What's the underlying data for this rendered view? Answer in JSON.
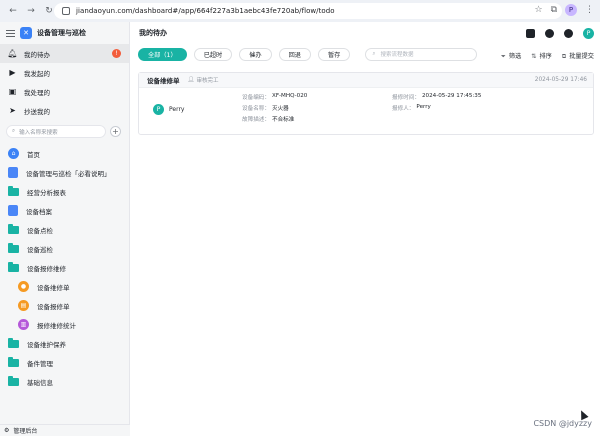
{
  "browser": {
    "url": "jiandaoyun.com/dashboard#/app/664f227a3b1aebc43fe720ab/flow/todo",
    "profile_initial": "P"
  },
  "app": {
    "title": "设备管理与巡检",
    "logo_glyph": "✕"
  },
  "sidebar": {
    "flow_items": [
      {
        "label": "我的待办",
        "icon": "bell-icon",
        "badge": "!"
      },
      {
        "label": "我发起的",
        "icon": "play-icon"
      },
      {
        "label": "我处理的",
        "icon": "inbox-icon"
      },
      {
        "label": "抄送我的",
        "icon": "send-icon"
      }
    ],
    "search_placeholder": "输入名称来搜索",
    "tree": [
      {
        "label": "首页",
        "icon": "home-icon"
      },
      {
        "label": "设备管理与巡检「必看说明」",
        "icon": "doc-icon"
      },
      {
        "label": "经营分析报表",
        "icon": "folder-icon"
      },
      {
        "label": "设备档案",
        "icon": "doc-icon"
      },
      {
        "label": "设备点检",
        "icon": "folder-icon"
      },
      {
        "label": "设备巡检",
        "icon": "folder-icon"
      },
      {
        "label": "设备报修维修",
        "icon": "folder-icon"
      },
      {
        "label": "设备维修单",
        "icon": "user-circle-icon",
        "color": "#f59a23",
        "sub": true
      },
      {
        "label": "设备报修单",
        "icon": "clipboard-circle-icon",
        "color": "#f59a23",
        "sub": true
      },
      {
        "label": "报修维修统计",
        "icon": "chart-circle-icon",
        "color": "#b558d9",
        "sub": true
      },
      {
        "label": "设备维护保养",
        "icon": "folder-icon"
      },
      {
        "label": "备件管理",
        "icon": "folder-icon"
      },
      {
        "label": "基础信息",
        "icon": "folder-icon"
      }
    ],
    "footer_label": "管理后台"
  },
  "main": {
    "title": "我的待办",
    "tabs": [
      {
        "label": "全部（1）",
        "active": true
      },
      {
        "label": "已超时"
      },
      {
        "label": "催办"
      },
      {
        "label": "回退"
      },
      {
        "label": "暂存"
      }
    ],
    "search_placeholder": "搜索流程数据",
    "actions": {
      "filter": "筛选",
      "sort": "排序",
      "batch": "批量提交"
    },
    "header_avatar": "P"
  },
  "card": {
    "title": "设备维修单",
    "node": "审核完工",
    "date": "2024-05-29 17:46",
    "owner": {
      "initial": "P",
      "name": "Perry"
    },
    "fields": [
      {
        "key": "设备编码：",
        "value": "XF-MHQ-020"
      },
      {
        "key": "报修时间：",
        "value": "2024-05-29 17:45:35"
      },
      {
        "key": "设备名称：",
        "value": "灭火器"
      },
      {
        "key": "报修人：",
        "value": "Perry"
      },
      {
        "key": "故障描述：",
        "value": "不合标准"
      }
    ]
  },
  "watermark": "CSDN @jdyzzy",
  "colors": {
    "accent": "#19b3a4",
    "badge": "#f25c3b",
    "brand_blue": "#3b82f6"
  }
}
